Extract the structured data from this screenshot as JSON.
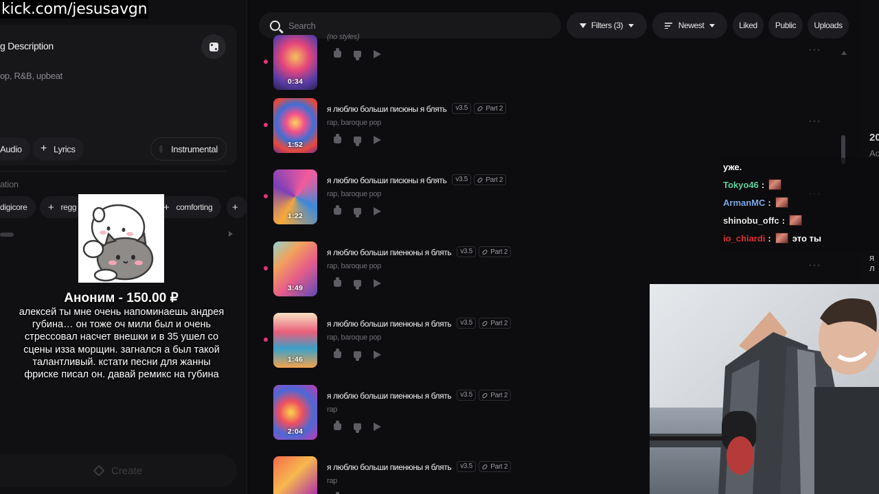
{
  "stream_url": "kick.com/jesusavgn",
  "left_panel": {
    "description_title": "g Description",
    "description_text": "op, R&B, upbeat",
    "audio_label": "Audio",
    "lyrics_label": "Lyrics",
    "instrumental_label": "Instrumental",
    "inspiration_label": "ation",
    "tags": [
      "digicore",
      "regg",
      "comforting"
    ],
    "create_label": "Create"
  },
  "donation": {
    "name": "Аноним - 150.00 ₽",
    "message": "алексей ты мне очень напоминаешь андрея губина… он тоже оч мили был и очень стрессовал насчет внешки и в 35 ушел со сцены изза морщин. загнался а был такой талантливый. кстати песни для жанны фриске писал он. давай ремикс на губина"
  },
  "search": {
    "placeholder": "Search"
  },
  "toolbar": {
    "filters_label": "Filters (3)",
    "sort_label": "Newest",
    "liked_label": "Liked",
    "public_label": "Public",
    "uploads_label": "Uploads"
  },
  "tracks": [
    {
      "title": "",
      "version": "",
      "part": "",
      "styles": "(no styles)",
      "duration": "0:34"
    },
    {
      "title": "я люблю больши писюны я блять",
      "version": "v3.5",
      "part": "Part 2",
      "styles": "rap, baroque pop",
      "duration": "1:52"
    },
    {
      "title": "я люблю больши писюны я блять",
      "version": "v3.5",
      "part": "Part 2",
      "styles": "rap, baroque pop",
      "duration": "1:22"
    },
    {
      "title": "я люблю больши пиенюны я блять",
      "version": "v3.5",
      "part": "Part 2",
      "styles": "rap, baroque pop",
      "duration": "3:49"
    },
    {
      "title": "я люблю больши пиенюны я блять",
      "version": "v3.5",
      "part": "Part 2",
      "styles": "rap, baroque pop",
      "duration": "1:46"
    },
    {
      "title": "я люблю больши пиенюны я блять",
      "version": "v3.5",
      "part": "Part 2",
      "styles": "rap",
      "duration": "2:04"
    },
    {
      "title": "я люблю больши пиенюны я блять",
      "version": "v3.5",
      "part": "Part 2",
      "styles": "rap",
      "duration": ""
    }
  ],
  "right_edge": {
    "line1": "20",
    "line2": "Ac",
    "line3": "я л"
  },
  "chat": {
    "first_line": "уже.",
    "messages": [
      {
        "user": "Tokyo46",
        "color": "#5fd3a0",
        "text": ""
      },
      {
        "user": "ArmanMC",
        "color": "#7fa8e8",
        "text": ""
      },
      {
        "user": "shinobu_offc",
        "color": "#e8e8e8",
        "text": ""
      },
      {
        "user": "io_chiardi",
        "color": "#e0303a",
        "text": "это ты"
      }
    ]
  },
  "colors": {
    "accent_dot": "#e6357e",
    "background": "#0d0d10"
  }
}
